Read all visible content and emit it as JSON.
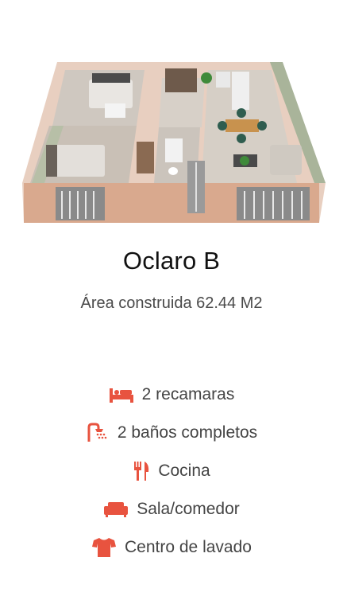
{
  "floorplan": {
    "image": "3d-floorplan-illustration"
  },
  "unit": {
    "name": "Oclaro B",
    "area": "Área construida 62.44 M2"
  },
  "features": [
    {
      "icon": "bed-icon",
      "label": "2 recamaras"
    },
    {
      "icon": "shower-icon",
      "label": "2 baños completos"
    },
    {
      "icon": "utensils-icon",
      "label": "Cocina"
    },
    {
      "icon": "sofa-icon",
      "label": "Sala/comedor"
    },
    {
      "icon": "tshirt-icon",
      "label": "Centro de lavado"
    }
  ],
  "colors": {
    "accent": "#e8533f"
  }
}
